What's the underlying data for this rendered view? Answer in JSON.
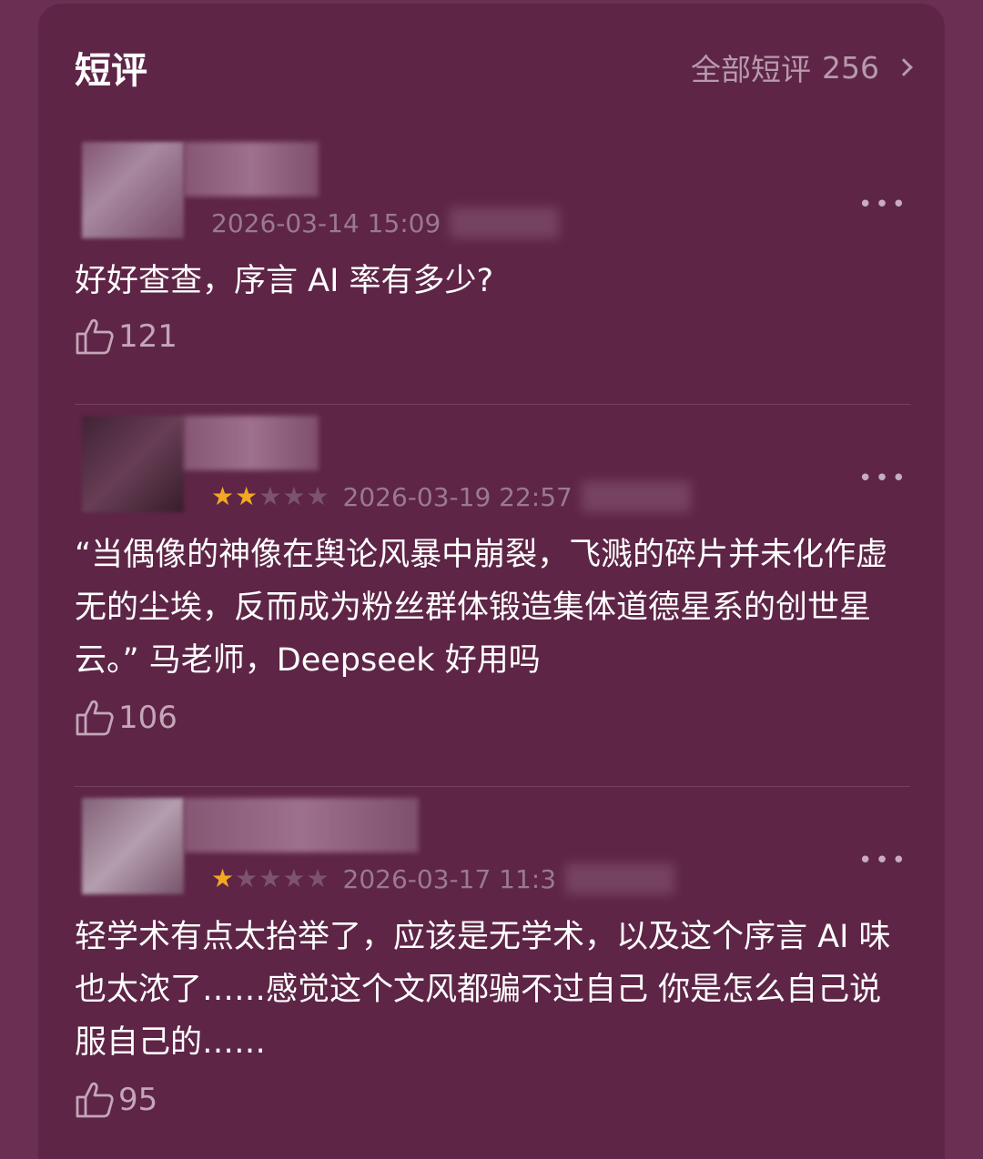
{
  "header": {
    "title": "短评",
    "all_reviews_label": "全部短评",
    "all_reviews_count": "256"
  },
  "reviews": [
    {
      "timestamp": "2026-03-14 15:09",
      "rating": null,
      "content": "好好查查，序言 AI 率有多少?",
      "likes": "121",
      "more_icon": "more-dots-icon"
    },
    {
      "timestamp": "2026-03-19 22:57",
      "rating": 2,
      "content": "“当偶像的神像在舆论风暴中崩裂，飞溅的碎片并未化作虚无的尘埃，反而成为粉丝群体锻造集体道德星系的创世星云。” 马老师，Deepseek 好用吗",
      "likes": "106",
      "more_icon": "more-dots-icon"
    },
    {
      "timestamp": "2026-03-17 11:3",
      "rating": 1,
      "content": "轻学术有点太抬举了，应该是无学术，以及这个序言 AI 味也太浓了……感觉这个文风都骗不过自己 你是怎么自己说服自己的……",
      "likes": "95",
      "more_icon": "more-dots-icon"
    }
  ],
  "colors": {
    "background": "#6a2f52",
    "card": "#5e2546",
    "star_on": "#f2a823",
    "muted_text": "#9a7a8e"
  }
}
